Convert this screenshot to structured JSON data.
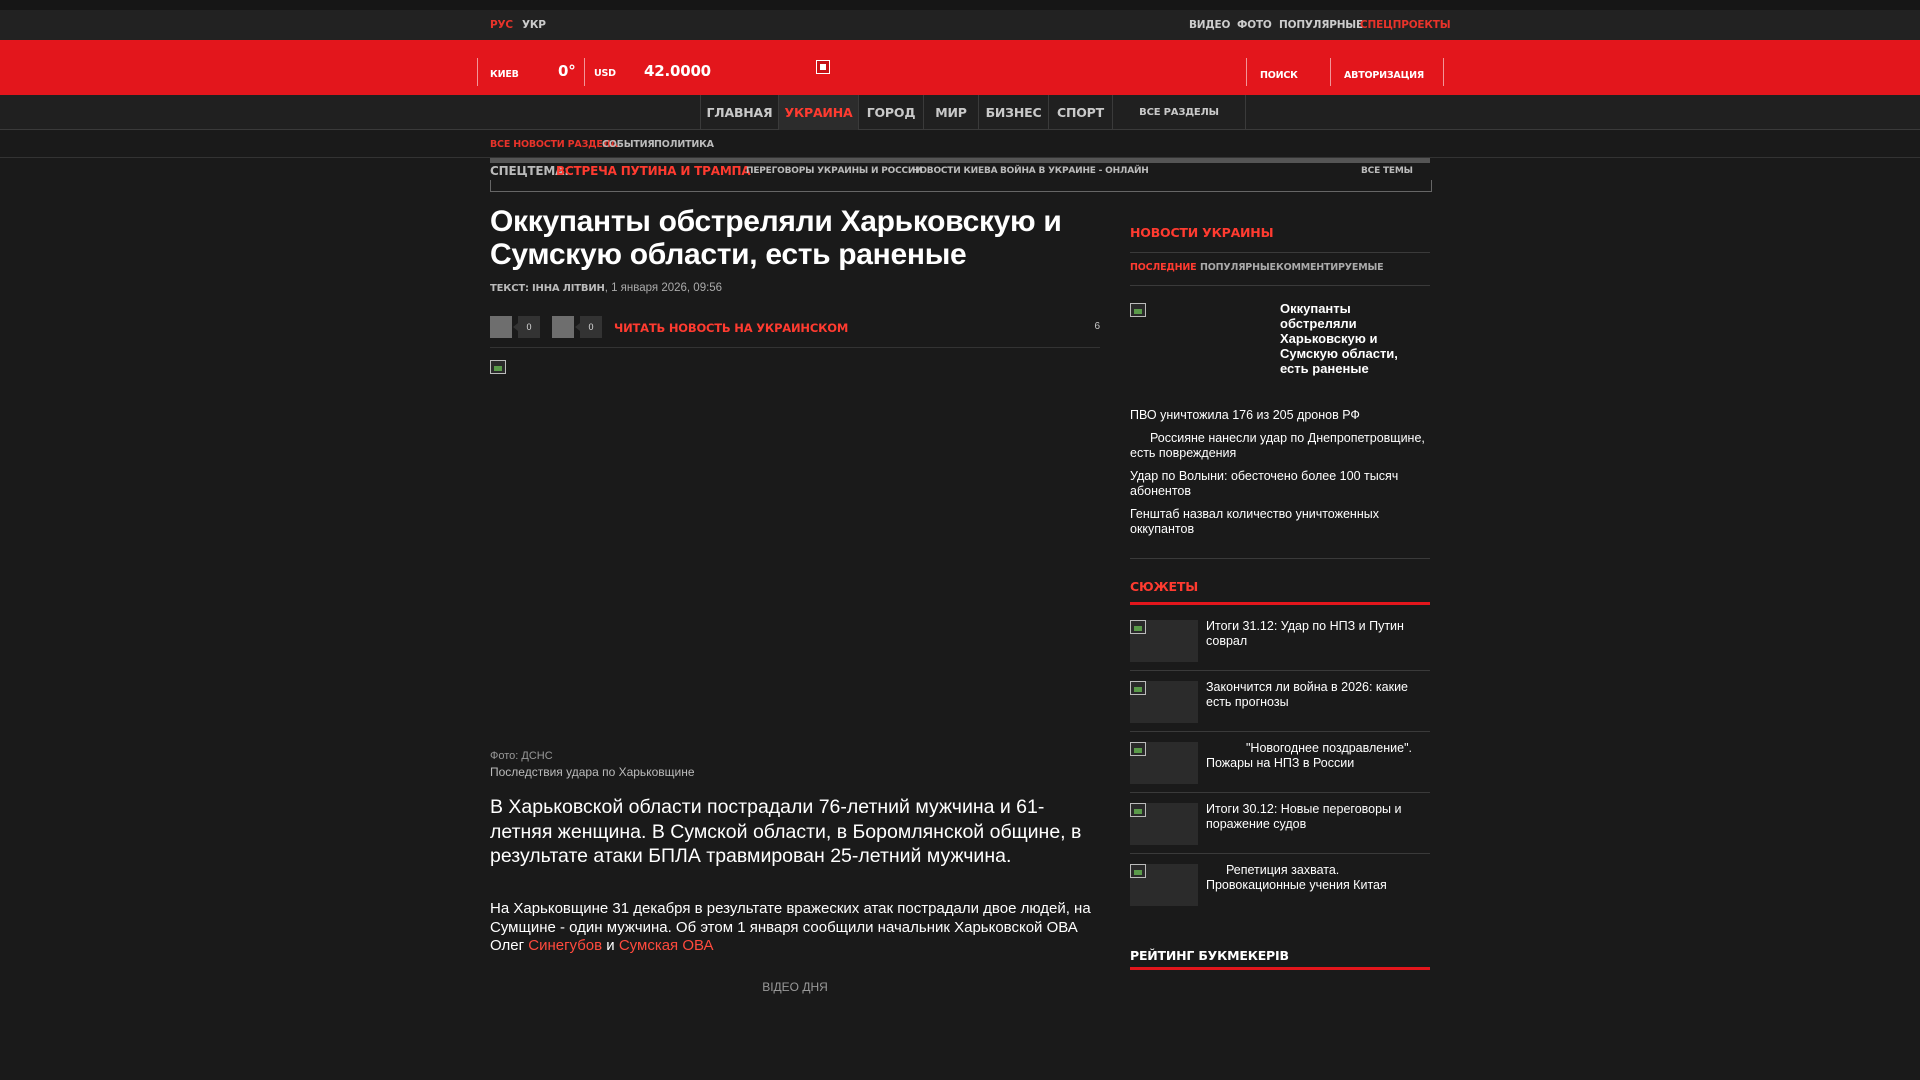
{
  "top_bar": {
    "lang_ru": "РУС",
    "lang_ua": "УКР",
    "links": [
      "ВИДЕО",
      "ФОТО",
      "ПОПУЛЯРНЫЕ",
      "СПЕЦПРОЕКТЫ"
    ]
  },
  "header": {
    "city": "КИЕВ",
    "temperature": "0°",
    "currency": "USD",
    "rate": "42.0000",
    "search": "ПОИСК",
    "login": "АВТОРИЗАЦИЯ"
  },
  "main_nav": {
    "items": [
      "ГЛАВНАЯ",
      "УКРАИНА",
      "ГОРОД",
      "МИР",
      "БИЗНЕС",
      "СПОРТ"
    ],
    "active_index": 1,
    "all_sections": "ВСЕ РАЗДЕЛЫ"
  },
  "sub_nav": {
    "items": [
      "ВСЕ НОВОСТИ РАЗДЕЛА",
      "СОБЫТИЯ",
      "ПОЛИТИКА"
    ]
  },
  "special_topic": {
    "label": "СПЕЦТЕМА:",
    "main": "ВСТРЕЧА ПУТИНА И ТРАМПА",
    "links": [
      "ПЕРЕГОВОРЫ УКРАИНЫ И РОССИИ",
      "НОВОСТИ КИЕВА",
      "ВОЙНА В УКРАИНЕ - ОНЛАЙН"
    ],
    "all_topics": "ВСЕ ТЕМЫ"
  },
  "article": {
    "headline": "Оккупанты обстреляли Харьковскую и Сумскую области, есть раненые",
    "author_label": "ТЕКСТ:",
    "author": "ІННА ЛІТВИН",
    "date": "1 января 2026, 09:56",
    "share_count_1": "0",
    "share_count_2": "0",
    "read_ukr": "ЧИТАТЬ НОВОСТЬ НА УКРАИНСКОМ",
    "comment_count": "6",
    "photo_credit": "Фото: ДСНС",
    "photo_caption": "Последствия удара по Харьковщине",
    "lead": "В Харьковской области пострадали 76-летний мужчина и 61-летняя женщина. В Сумской области, в Боромлянской общине, в результате атаки БПЛА травмирован 25-летний мужчина.",
    "body_part1": "На Харьковщине 31 декабря в результате вражеских атак пострадали двое людей, на Сумщине - один мужчина. Об этом 1 января сообщили начальник Харьковской ОВА Олег ",
    "body_link1": "Синегубов",
    "body_mid": " и ",
    "body_link2": "Сумская ОВА",
    "video_label": "ВІДЕО ДНЯ"
  },
  "sidebar": {
    "news_title": "НОВОСТИ УКРАИНЫ",
    "tabs": [
      "ПОСЛЕДНИЕ",
      "ПОПУЛЯРНЫЕ",
      "КОММЕНТИРУЕМЫЕ"
    ],
    "featured": "Оккупанты обстреляли Харьковскую и Сумскую области, есть раненые",
    "news": [
      "ПВО уничтожила 176 из 205 дронов РФ",
      "Россияне нанесли удар по Днепропетровщине, есть повреждения",
      "Удар по Волыни: обесточено более 100 тысяч абонентов",
      "Генштаб назвал количество уничтоженных оккупантов"
    ],
    "stories_title": "СЮЖЕТЫ",
    "stories": [
      "Итоги 31.12: Удар по НПЗ и Путин соврал",
      "Закончится ли война в 2026: какие есть прогнозы",
      "\"Новогоднее поздравление\". Пожары на НПЗ в России",
      "Итоги 30.12: Новые переговоры и поражение судов",
      "Репетиция захвата. Провокационные учения Китая"
    ],
    "rating_title": "РЕЙТИНГ БУКМЕКЕРІВ"
  },
  "colors": {
    "brand_red": "#e3161c",
    "link_red": "#ff3b30",
    "background": "#1a1a1a"
  }
}
